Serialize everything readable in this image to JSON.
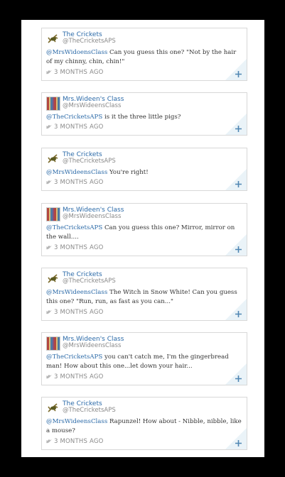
{
  "tweets": [
    {
      "name": "The Crickets",
      "handle": "@TheCricketsAPS",
      "avatar": "cricket",
      "mention": "@MrsWidoensClass",
      "text": " Can you guess this one? \"Not by the hair of my chinny, chin, chin!\"",
      "time": "3 MONTHS AGO"
    },
    {
      "name": "Mrs.Wideen's Class",
      "handle": "@MrsWideensClass",
      "avatar": "class",
      "mention": "@TheCricketsAPS",
      "text": " is it the three little pigs?",
      "time": "3 MONTHS AGO"
    },
    {
      "name": "The Crickets",
      "handle": "@TheCricketsAPS",
      "avatar": "cricket",
      "mention": "@MrsWideensClass",
      "text": " You're right!",
      "time": "3 MONTHS AGO"
    },
    {
      "name": "Mrs.Wideen's Class",
      "handle": "@MrsWideensClass",
      "avatar": "class",
      "mention": "@TheCricketsAPS",
      "text": " Can you guess this one? Mirror, mirror on the wall....",
      "time": "3 MONTHS AGO"
    },
    {
      "name": "The Crickets",
      "handle": "@TheCricketsAPS",
      "avatar": "cricket",
      "mention": "@MrsWideensClass",
      "text": " The Witch in Snow White! Can you guess this one? \"Run, run, as fast as you can...\"",
      "time": "3 MONTHS AGO"
    },
    {
      "name": "Mrs.Wideen's Class",
      "handle": "@MrsWideensClass",
      "avatar": "class",
      "mention": "@TheCricketsAPS",
      "text": " you can't catch me, I'm the gingerbread man! How about this one...let down your hair...",
      "time": "3 MONTHS AGO"
    },
    {
      "name": "The Crickets",
      "handle": "@TheCricketsAPS",
      "avatar": "cricket",
      "mention": "@MrsWideensClass",
      "text": " Rapunzel! How about - Nibble, nibble, like a mouse?",
      "time": "3 MONTHS AGO"
    }
  ],
  "colors": {
    "link": "#2b6aa8",
    "muted": "#8a8a8a",
    "border": "#d8d8d8"
  },
  "icons": {
    "timestamp": "bird-icon",
    "action": "plus-icon"
  }
}
